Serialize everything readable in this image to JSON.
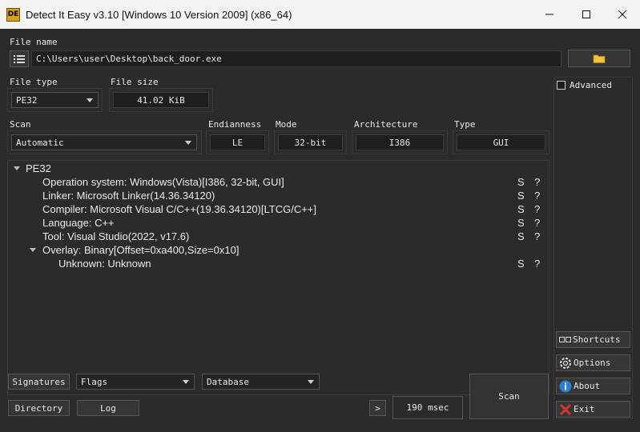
{
  "window": {
    "title": "Detect It Easy v3.10 [Windows 10 Version 2009] (x86_64)",
    "icon": "die-logo-icon",
    "controls": [
      "minimize-icon",
      "maximize-icon",
      "close-icon"
    ]
  },
  "file": {
    "label": "File name",
    "path": "C:\\Users\\user\\Desktop\\back_door.exe"
  },
  "file_type": {
    "label": "File type",
    "value": "PE32"
  },
  "file_size": {
    "label": "File size",
    "value": "41.02 KiB"
  },
  "scan_mode": {
    "label": "Scan",
    "value": "Automatic"
  },
  "endianness": {
    "label": "Endianness",
    "value": "LE"
  },
  "mode": {
    "label": "Mode",
    "value": "32-bit"
  },
  "architecture": {
    "label": "Architecture",
    "value": "I386"
  },
  "type": {
    "label": "Type",
    "value": "GUI"
  },
  "results": {
    "root": "PE32",
    "items": [
      {
        "text": "Operation system: Windows(Vista)[I386, 32-bit, GUI]",
        "s": "S",
        "q": "?"
      },
      {
        "text": "Linker: Microsoft Linker(14.36.34120)",
        "s": "S",
        "q": "?"
      },
      {
        "text": "Compiler: Microsoft Visual C/C++(19.36.34120)[LTCG/C++]",
        "s": "S",
        "q": "?"
      },
      {
        "text": "Language: C++",
        "s": "S",
        "q": "?"
      },
      {
        "text": "Tool: Visual Studio(2022, v17.6)",
        "s": "S",
        "q": "?"
      },
      {
        "text": "Overlay: Binary[Offset=0xa400,Size=0x10]",
        "s": "",
        "q": ""
      },
      {
        "text": "Unknown: Unknown",
        "s": "S",
        "q": "?"
      }
    ]
  },
  "side": {
    "advanced": "Advanced",
    "shortcuts": "Shortcuts",
    "options": "Options",
    "about": "About",
    "exit": "Exit"
  },
  "bottom": {
    "signatures": "Signatures",
    "flags": "Flags",
    "database": "Database",
    "directory": "Directory",
    "log": "Log",
    "next": ">",
    "time": "190 msec",
    "scan": "Scan"
  },
  "colors": {
    "background": "#2b2b2b",
    "titlebar": "#f3f3f3",
    "folder": "#f0c23a",
    "info_blue": "#2a7fd4",
    "exit_red": "#d9342b"
  }
}
